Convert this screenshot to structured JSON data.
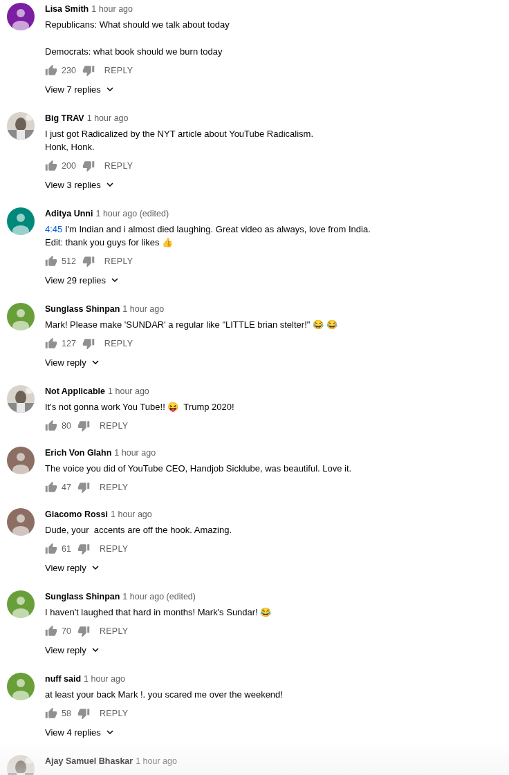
{
  "comments": [
    {
      "avatar": {
        "kind": "default",
        "color": "#7b1fa2"
      },
      "author": "Lisa Smith",
      "time": "1 hour ago",
      "paragraphs": [
        [
          {
            "text": "Republicans: What should we talk about today"
          }
        ],
        [
          {
            "text": "Democrats: what book should we burn today"
          }
        ]
      ],
      "likes": "230",
      "reply": "REPLY",
      "replies": "View 7 replies"
    },
    {
      "avatar": {
        "kind": "picture"
      },
      "author": "Big TRAV",
      "time": "1 hour ago",
      "paragraphs": [
        [
          {
            "text": "I just got Radicalized by the NYT article about YouTube Radicalism."
          },
          {
            "text": "Honk, Honk."
          }
        ]
      ],
      "likes": "200",
      "reply": "REPLY",
      "replies": "View 3 replies"
    },
    {
      "avatar": {
        "kind": "default",
        "color": "#00897b"
      },
      "author": "Aditya Unni",
      "time": "1 hour ago (edited)",
      "paragraphs": [
        [
          {
            "link": "4:45",
            "text": "I'm Indian and i almost died laughing. Great video as always, love from India."
          },
          {
            "text": "Edit: thank you guys for likes 👍"
          }
        ]
      ],
      "likes": "512",
      "reply": "REPLY",
      "replies": "View 29 replies"
    },
    {
      "avatar": {
        "kind": "default",
        "color": "#689f38"
      },
      "author": "Sunglass Shinpan",
      "time": "1 hour ago",
      "paragraphs": [
        [
          {
            "text": "Mark! Please make 'SUNDAR' a regular like \"LITTLE brian stelter!\" 😂 😂"
          }
        ]
      ],
      "likes": "127",
      "reply": "REPLY",
      "replies": "View reply"
    },
    {
      "avatar": {
        "kind": "picture"
      },
      "author": "Not Applicable",
      "time": "1 hour ago",
      "paragraphs": [
        [
          {
            "text": "It's not gonna work You Tube!! 😝  Trump 2020!"
          }
        ]
      ],
      "likes": "80",
      "reply": "REPLY"
    },
    {
      "avatar": {
        "kind": "default",
        "color": "#8d6e63"
      },
      "author": "Erich Von Glahn",
      "time": "1 hour ago",
      "paragraphs": [
        [
          {
            "text": "The voice you did of YouTube CEO, Handjob Sicklube, was beautiful. Love it."
          }
        ]
      ],
      "likes": "47",
      "reply": "REPLY"
    },
    {
      "avatar": {
        "kind": "default",
        "color": "#8d6e63"
      },
      "author": "Giacomo Rossi",
      "time": "1 hour ago",
      "paragraphs": [
        [
          {
            "text": "Dude, your  accents are off the hook. Amazing."
          }
        ]
      ],
      "likes": "61",
      "reply": "REPLY",
      "replies": "View reply"
    },
    {
      "avatar": {
        "kind": "default",
        "color": "#689f38"
      },
      "author": "Sunglass Shinpan",
      "time": "1 hour ago (edited)",
      "paragraphs": [
        [
          {
            "text": "I haven't laughed that hard in months! Mark's Sundar! 😂"
          }
        ]
      ],
      "likes": "70",
      "reply": "REPLY",
      "replies": "View reply"
    },
    {
      "avatar": {
        "kind": "default",
        "color": "#689f38"
      },
      "author": "nuff said",
      "time": "1 hour ago",
      "paragraphs": [
        [
          {
            "text": "at least your back Mark !. you scared me over the weekend!"
          }
        ]
      ],
      "likes": "58",
      "reply": "REPLY",
      "replies": "View 4 replies"
    },
    {
      "avatar": {
        "kind": "picture"
      },
      "author": "Ajay Samuel Bhaskar",
      "time": "1 hour ago"
    }
  ]
}
